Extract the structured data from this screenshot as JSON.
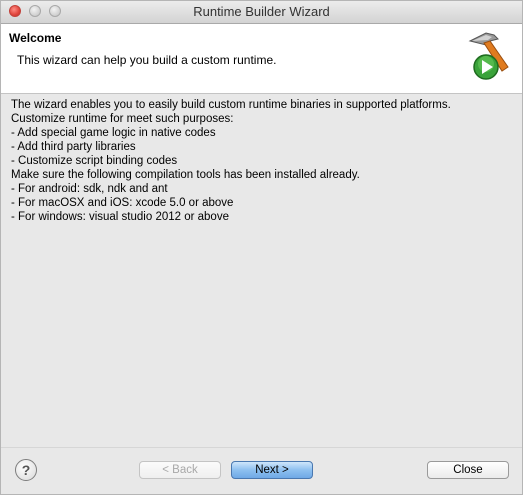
{
  "window": {
    "title": "Runtime Builder Wizard"
  },
  "header": {
    "title": "Welcome",
    "description": "This wizard can help you build a custom runtime.",
    "icon": "hammer-play-icon"
  },
  "content": {
    "lines": [
      "The wizard enables you to easily build custom runtime binaries in supported platforms.",
      "Customize runtime for meet such purposes:",
      "- Add special game logic in native codes",
      "- Add third party libraries",
      "- Customize script binding codes",
      "Make sure the following compilation tools has been installed already.",
      "- For android: sdk, ndk and ant",
      "- For macOSX and iOS: xcode 5.0 or above",
      "- For windows: visual studio 2012 or above"
    ]
  },
  "footer": {
    "help_icon": "question-mark-icon",
    "help_glyph": "?",
    "back_label": "< Back",
    "next_label": "Next >",
    "close_label": "Close"
  },
  "colors": {
    "accent": "#6fa9e6",
    "header_bg": "#ffffff",
    "window_bg": "#e8e8e8",
    "play_green": "#3aa33a",
    "hammer_orange": "#e07b1f"
  }
}
